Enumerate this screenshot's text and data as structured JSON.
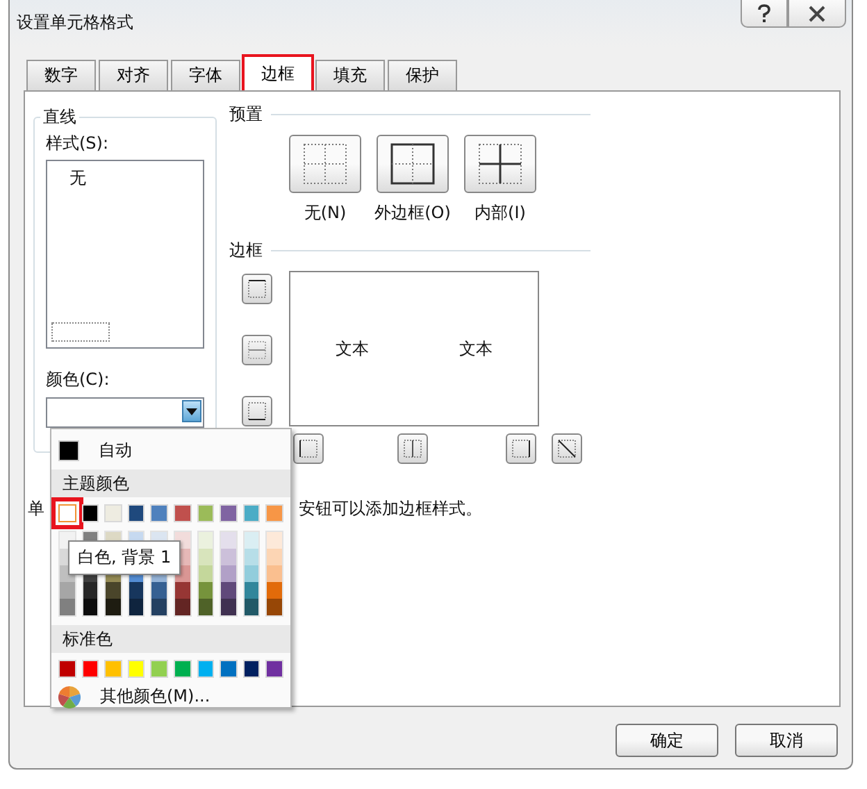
{
  "window": {
    "title": "设置单元格格式"
  },
  "tabs": [
    {
      "label": "数字",
      "selected": false,
      "highlighted": false
    },
    {
      "label": "对齐",
      "selected": false,
      "highlighted": false
    },
    {
      "label": "字体",
      "selected": false,
      "highlighted": false
    },
    {
      "label": "边框",
      "selected": true,
      "highlighted": true
    },
    {
      "label": "填充",
      "selected": false,
      "highlighted": false
    },
    {
      "label": "保护",
      "selected": false,
      "highlighted": false
    }
  ],
  "line_group": {
    "title": "直线",
    "style_label": "样式(S):",
    "style_none": "无",
    "color_label": "颜色(C):"
  },
  "presets": {
    "title": "预置",
    "items": [
      {
        "kind": "none",
        "label": "无(N)"
      },
      {
        "kind": "outline",
        "label": "外边框(O)"
      },
      {
        "kind": "inside",
        "label": "内部(I)"
      }
    ]
  },
  "border": {
    "title": "边框",
    "preview_texts": [
      "文本",
      "文本"
    ]
  },
  "hint_fragments": [
    "单",
    "安钮可以添加边框样式。"
  ],
  "color_menu": {
    "auto_label": "自动",
    "theme_title": "主题颜色",
    "tooltip": "白色, 背景 1",
    "standard_title": "标准色",
    "more_label": "其他颜色(M)...",
    "theme_columns": [
      {
        "color": "#ffffff",
        "selected": true,
        "shades": [
          {
            "color": "#f2f2f2"
          },
          {
            "color": "#d9d9d9"
          },
          {
            "color": "#bfbfbf"
          },
          {
            "color": "#a6a6a6"
          },
          {
            "color": "#808080"
          }
        ]
      },
      {
        "color": "#000000",
        "selected": false,
        "shades": [
          {
            "color": "#808080"
          }
        ],
        "shades_below_tooltip": [
          {
            "color": "#404040"
          },
          {
            "color": "#262626"
          },
          {
            "color": "#0d0d0d"
          }
        ]
      },
      {
        "color": "#eeece1",
        "selected": false,
        "shades": [
          {
            "color": "#ddd9c4"
          }
        ],
        "shades_below_tooltip": [
          {
            "color": "#948a54"
          },
          {
            "color": "#4a452a"
          },
          {
            "color": "#1e1c11"
          }
        ]
      },
      {
        "color": "#1f497d",
        "selected": false,
        "shades": [
          {
            "color": "#c6d9f0"
          }
        ],
        "shades_below_tooltip": [
          {
            "color": "#548dd4"
          },
          {
            "color": "#17365d"
          },
          {
            "color": "#0f243e"
          }
        ]
      },
      {
        "color": "#4f81bd",
        "selected": false,
        "shades": [
          {
            "color": "#dbe5f1"
          }
        ],
        "shades_below_tooltip": [
          {
            "color": "#95b3d7"
          },
          {
            "color": "#366092"
          },
          {
            "color": "#244061"
          }
        ]
      },
      {
        "color": "#c0504d",
        "selected": false,
        "shades": [
          {
            "color": "#f2dcdb"
          },
          {
            "color": "#e6b8b7"
          },
          {
            "color": "#da9694"
          },
          {
            "color": "#963634"
          },
          {
            "color": "#632523"
          }
        ]
      },
      {
        "color": "#9bbb59",
        "selected": false,
        "shades": [
          {
            "color": "#ebf1de"
          },
          {
            "color": "#d8e4bc"
          },
          {
            "color": "#c4d79b"
          },
          {
            "color": "#76933c"
          },
          {
            "color": "#4f6228"
          }
        ]
      },
      {
        "color": "#8064a2",
        "selected": false,
        "shades": [
          {
            "color": "#e4dfec"
          },
          {
            "color": "#ccc0da"
          },
          {
            "color": "#b1a0c7"
          },
          {
            "color": "#60497a"
          },
          {
            "color": "#403151"
          }
        ]
      },
      {
        "color": "#4bacc6",
        "selected": false,
        "shades": [
          {
            "color": "#daeef3"
          },
          {
            "color": "#b7dee8"
          },
          {
            "color": "#92cddc"
          },
          {
            "color": "#31869b"
          },
          {
            "color": "#215967"
          }
        ]
      },
      {
        "color": "#f79646",
        "selected": false,
        "shades": [
          {
            "color": "#fde9d9"
          },
          {
            "color": "#fcd5b4"
          },
          {
            "color": "#fabf8f"
          },
          {
            "color": "#e26b0a"
          },
          {
            "color": "#974706"
          }
        ]
      }
    ],
    "standard": [
      {
        "color": "#c00000"
      },
      {
        "color": "#ff0000"
      },
      {
        "color": "#ffc000"
      },
      {
        "color": "#ffff00"
      },
      {
        "color": "#92d050"
      },
      {
        "color": "#00b050"
      },
      {
        "color": "#00b0f0"
      },
      {
        "color": "#0070c0"
      },
      {
        "color": "#002060"
      },
      {
        "color": "#7030a0"
      }
    ]
  },
  "buttons": [
    {
      "label": "确定"
    },
    {
      "label": "取消"
    }
  ]
}
